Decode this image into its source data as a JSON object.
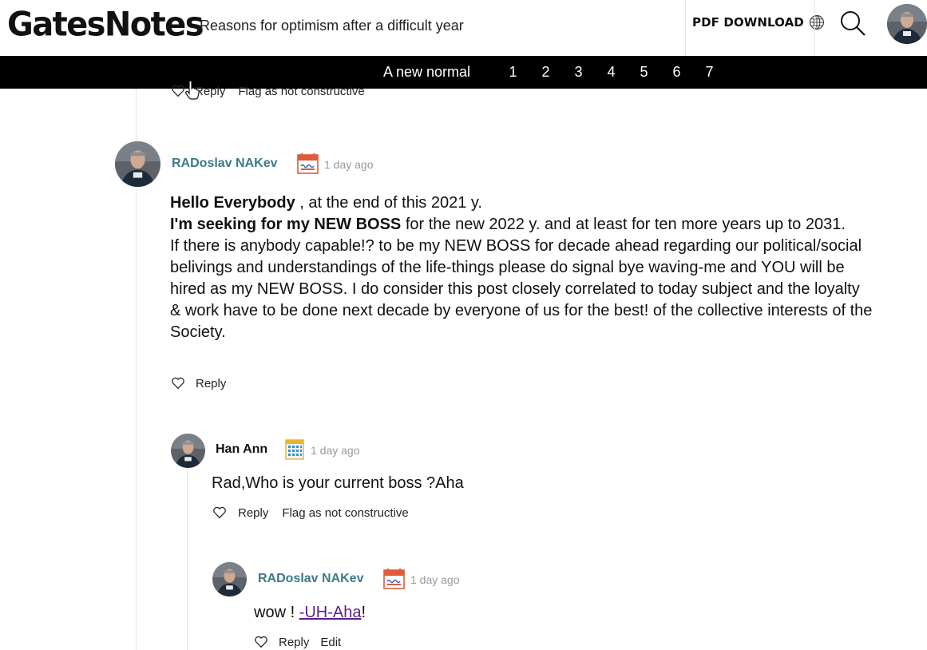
{
  "header": {
    "logo": "GatesNotes",
    "subtitle": "Reasons for optimism after a difficult year",
    "pdf_label": "PDF DOWNLOAD",
    "icons": [
      "globe-icon",
      "search-icon",
      "avatar"
    ]
  },
  "nav": {
    "title": "A new normal",
    "chapters": [
      "1",
      "2",
      "3",
      "4",
      "5",
      "6",
      "7"
    ]
  },
  "top_actions": {
    "reply": "Reply",
    "flag": "Flag as not constructive"
  },
  "comments": [
    {
      "author": "RADoslav NAKev",
      "time": "1 day ago",
      "badge": "red-calendar-badge",
      "p1_bold": "Hello Everybody",
      "p1_rest": " , at the end of this 2021 y.",
      "p2_bold": "I'm seeking for my NEW BOSS",
      "p2_rest": " for the new 2022 y. and at least for ten more years up to 2031.",
      "p3": "If there is anybody capable!? to be my NEW BOSS for decade ahead regarding our political/social belivings and understandings of the life-things please do signal bye waving-me and YOU will be hired as my NEW BOSS. I do consider this post closely correlated to today subject and the loyalty & work have to be done next decade by everyone of us for the best! of the collective interests of the Society.",
      "reply": "Reply"
    },
    {
      "author": "Han Ann",
      "time": "1 day ago",
      "badge": "blue-grid-badge",
      "text": "Rad,Who is your current boss ?Aha",
      "reply": "Reply",
      "flag": "Flag as not constructive"
    },
    {
      "author": "RADoslav NAKev",
      "time": "1 day ago",
      "badge": "red-calendar-badge",
      "text_before": "wow ! ",
      "link": "-UH-Aha",
      "text_after": "!",
      "reply": "Reply",
      "edit": "Edit"
    }
  ],
  "colors": {
    "teal_author": "#3b7a88",
    "link_purple": "#5b1f8f",
    "nav_bg": "#000000",
    "timestamp": "#9a9a9a"
  }
}
